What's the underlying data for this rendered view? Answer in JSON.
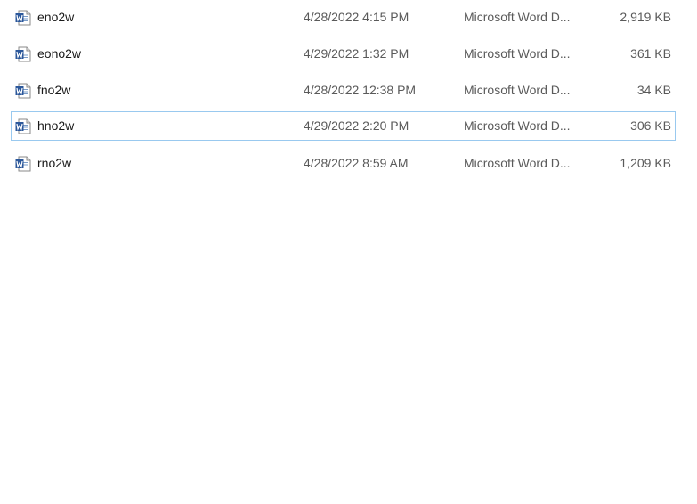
{
  "files": [
    {
      "name": "eno2w",
      "date": "4/28/2022 4:15 PM",
      "type": "Microsoft Word D...",
      "size": "2,919 KB",
      "icon": "word-document-icon"
    },
    {
      "name": "eono2w",
      "date": "4/29/2022 1:32 PM",
      "type": "Microsoft Word D...",
      "size": "361 KB",
      "icon": "word-document-icon"
    },
    {
      "name": "fno2w",
      "date": "4/28/2022 12:38 PM",
      "type": "Microsoft Word D...",
      "size": "34 KB",
      "icon": "word-document-icon"
    },
    {
      "name": "hno2w",
      "date": "4/29/2022 2:20 PM",
      "type": "Microsoft Word D...",
      "size": "306 KB",
      "icon": "word-document-icon"
    },
    {
      "name": "rno2w",
      "date": "4/28/2022 8:59 AM",
      "type": "Microsoft Word D...",
      "size": "1,209 KB",
      "icon": "word-document-icon"
    }
  ],
  "colors": {
    "word_blue": "#2b579a",
    "focus_border": "#99c9ef"
  }
}
